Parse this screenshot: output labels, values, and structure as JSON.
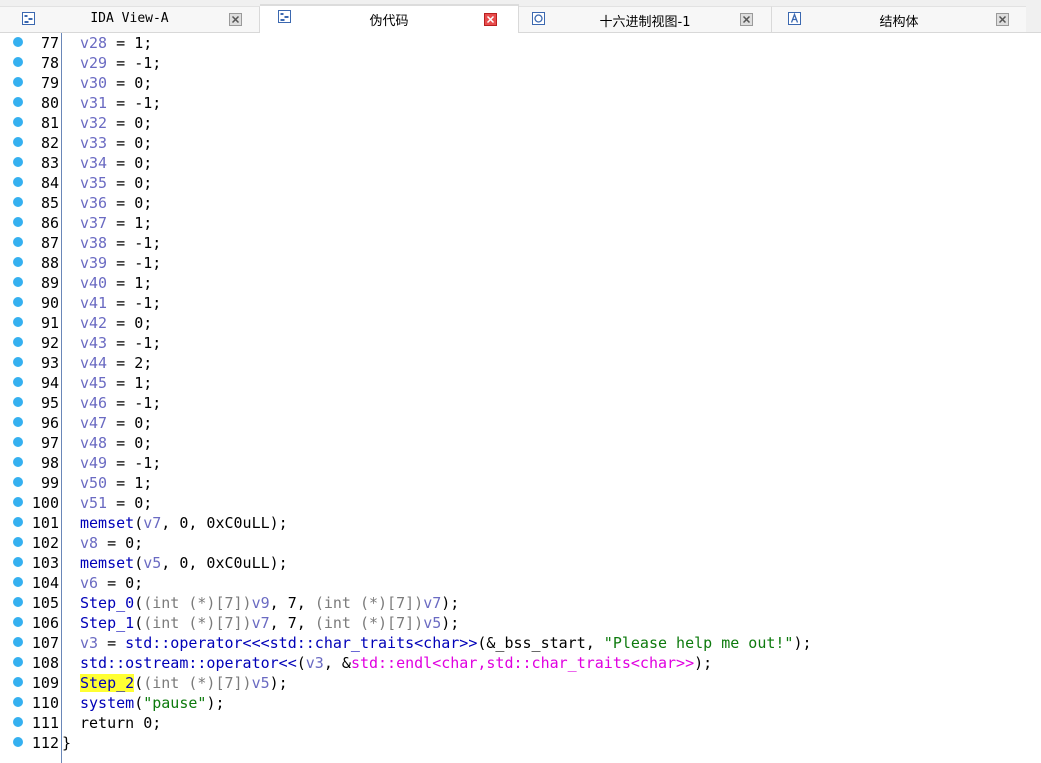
{
  "tabs": [
    {
      "label": "IDA View-A",
      "icon": "ida-view-icon",
      "active": false
    },
    {
      "label": "伪代码",
      "icon": "pseudocode-icon",
      "active": true
    },
    {
      "label": "十六进制视图-1",
      "icon": "hex-view-icon",
      "active": false
    },
    {
      "label": "结构体",
      "icon": "structures-icon",
      "active": false
    }
  ],
  "colors": {
    "breakpoint_dot": "#35b0f0",
    "variable": "#6a6ac2",
    "type": "#7b7b7b",
    "function": "#0000b8",
    "string": "#0d7a0d",
    "template": "#e000e0",
    "highlight": "#ffff33",
    "close_button": "#d23030"
  },
  "code": {
    "assignments": [
      {
        "ln": "77",
        "var": "v28",
        "val": "1"
      },
      {
        "ln": "78",
        "var": "v29",
        "val": "-1"
      },
      {
        "ln": "79",
        "var": "v30",
        "val": "0"
      },
      {
        "ln": "80",
        "var": "v31",
        "val": "-1"
      },
      {
        "ln": "81",
        "var": "v32",
        "val": "0"
      },
      {
        "ln": "82",
        "var": "v33",
        "val": "0"
      },
      {
        "ln": "83",
        "var": "v34",
        "val": "0"
      },
      {
        "ln": "84",
        "var": "v35",
        "val": "0"
      },
      {
        "ln": "85",
        "var": "v36",
        "val": "0"
      },
      {
        "ln": "86",
        "var": "v37",
        "val": "1"
      },
      {
        "ln": "87",
        "var": "v38",
        "val": "-1"
      },
      {
        "ln": "88",
        "var": "v39",
        "val": "-1"
      },
      {
        "ln": "89",
        "var": "v40",
        "val": "1"
      },
      {
        "ln": "90",
        "var": "v41",
        "val": "-1"
      },
      {
        "ln": "91",
        "var": "v42",
        "val": "0"
      },
      {
        "ln": "92",
        "var": "v43",
        "val": "-1"
      },
      {
        "ln": "93",
        "var": "v44",
        "val": "2"
      },
      {
        "ln": "94",
        "var": "v45",
        "val": "1"
      },
      {
        "ln": "95",
        "var": "v46",
        "val": "-1"
      },
      {
        "ln": "96",
        "var": "v47",
        "val": "0"
      },
      {
        "ln": "97",
        "var": "v48",
        "val": "0"
      },
      {
        "ln": "98",
        "var": "v49",
        "val": "-1"
      },
      {
        "ln": "99",
        "var": "v50",
        "val": "1"
      },
      {
        "ln": "100",
        "var": "v51",
        "val": "0"
      }
    ],
    "l101": {
      "ln": "101",
      "fn": "memset",
      "arg": "v7",
      "rest": ", 0, 0xC0uLL);"
    },
    "l102": {
      "ln": "102",
      "var": "v8",
      "rest": " = 0;"
    },
    "l103": {
      "ln": "103",
      "fn": "memset",
      "arg": "v5",
      "rest": ", 0, 0xC0uLL);"
    },
    "l104": {
      "ln": "104",
      "var": "v6",
      "rest": " = 0;"
    },
    "l105": {
      "ln": "105",
      "fn": "Step_0",
      "cast": "(int (*)[7])",
      "a1": "v9",
      "mid": ", 7, ",
      "a2": "v7"
    },
    "l106": {
      "ln": "106",
      "fn": "Step_1",
      "cast": "(int (*)[7])",
      "a1": "v7",
      "mid": ", 7, ",
      "a2": "v5"
    },
    "l107": {
      "ln": "107",
      "var": "v3",
      "eq": " = ",
      "fn": "std::operator<<<std::char_traits<char>>",
      "pre": "(&_bss_start, ",
      "str": "\"Please help me out!\"",
      "post": ");"
    },
    "l108": {
      "ln": "108",
      "fn": "std::ostream::operator<<",
      "arg": "v3",
      "mid": ", &",
      "tmpl": "std::endl<char,std::char_traits<char>>",
      "post": ");"
    },
    "l109": {
      "ln": "109",
      "fn": "Step_2",
      "cast": "(int (*)[7])",
      "arg": "v5",
      "post": ");"
    },
    "l110": {
      "ln": "110",
      "fn": "system",
      "str": "\"pause\"",
      "post": ");"
    },
    "l111": {
      "ln": "111",
      "text": "return 0;"
    },
    "l112": {
      "ln": "112",
      "brace": "}"
    }
  }
}
